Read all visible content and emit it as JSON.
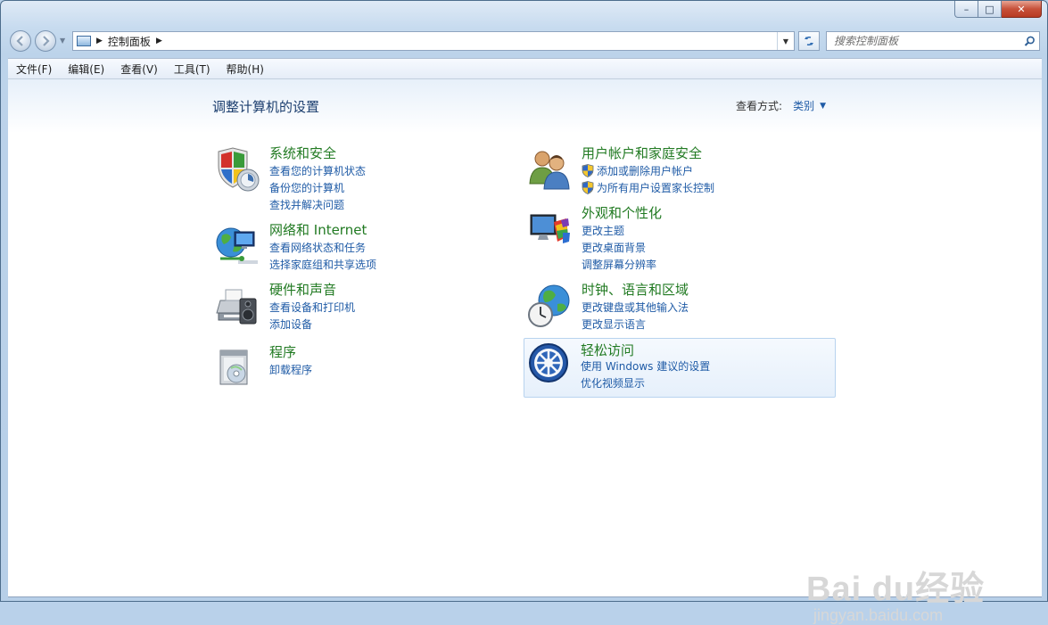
{
  "window": {
    "min_label": "–",
    "max_label": "□",
    "close_label": "✕"
  },
  "nav": {
    "breadcrumb": "控制面板",
    "search_placeholder": "搜索控制面板"
  },
  "menu": [
    "文件(F)",
    "编辑(E)",
    "查看(V)",
    "工具(T)",
    "帮助(H)"
  ],
  "page": {
    "title": "调整计算机的设置",
    "viewby_label": "查看方式:",
    "viewby_value": "类别"
  },
  "categories": [
    {
      "title": "系统和安全",
      "icon": "system-security-icon",
      "links": [
        "查看您的计算机状态",
        "备份您的计算机",
        "查找并解决问题"
      ]
    },
    {
      "title": "用户帐户和家庭安全",
      "icon": "user-accounts-icon",
      "links": [
        "添加或删除用户帐户",
        "为所有用户设置家长控制"
      ]
    },
    {
      "title": "网络和 Internet",
      "icon": "network-icon",
      "links": [
        "查看网络状态和任务",
        "选择家庭组和共享选项"
      ]
    },
    {
      "title": "外观和个性化",
      "icon": "appearance-icon",
      "links": [
        "更改主题",
        "更改桌面背景",
        "调整屏幕分辨率"
      ]
    },
    {
      "title": "硬件和声音",
      "icon": "hardware-sound-icon",
      "links": [
        "查看设备和打印机",
        "添加设备"
      ]
    },
    {
      "title": "时钟、语言和区域",
      "icon": "clock-region-icon",
      "links": [
        "更改键盘或其他输入法",
        "更改显示语言"
      ]
    },
    {
      "title": "程序",
      "icon": "programs-icon",
      "links": [
        "卸载程序"
      ]
    },
    {
      "title": "轻松访问",
      "icon": "ease-of-access-icon",
      "links": [
        "使用 Windows 建议的设置",
        "优化视频显示"
      ]
    }
  ],
  "watermark": {
    "brand": "Bai du经验",
    "url": "jingyan.baidu.com"
  }
}
